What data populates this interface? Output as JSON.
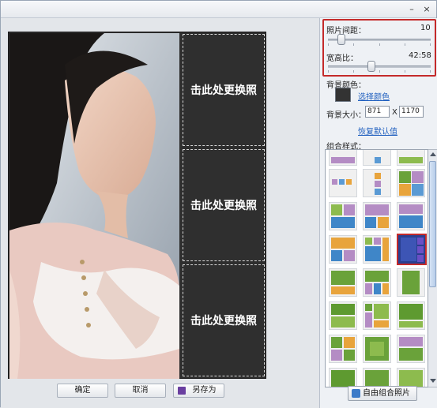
{
  "window": {
    "minimize_glyph": "–",
    "close_glyph": "×"
  },
  "canvas": {
    "slots": [
      {
        "label": "击此处更换照"
      },
      {
        "label": "击此处更换照"
      },
      {
        "label": "击此处更换照"
      }
    ]
  },
  "actions": {
    "ok_label": "确定",
    "cancel_label": "取消",
    "save_as_label": "另存为"
  },
  "settings": {
    "spacing_label": "照片间距：",
    "spacing_value": "10",
    "spacing_fraction": 0.1,
    "ratio_label": "宽高比：",
    "ratio_value": "42:58",
    "ratio_fraction": 0.42,
    "bg_color_label": "背景颜色：",
    "bg_color": "#333333",
    "choose_color_link": "选择颜色",
    "bg_size_label": "背景大小：",
    "bg_width": "871",
    "size_separator": "X",
    "bg_height": "1170",
    "restore_default_link": "恢复默认值",
    "combo_style_label": "组合样式：",
    "free_combine_label": "自由组合照片"
  },
  "colors": {
    "highlight_border": "#c42a2a",
    "link": "#1f5fbf",
    "selected_template": "#2a3f8f"
  }
}
